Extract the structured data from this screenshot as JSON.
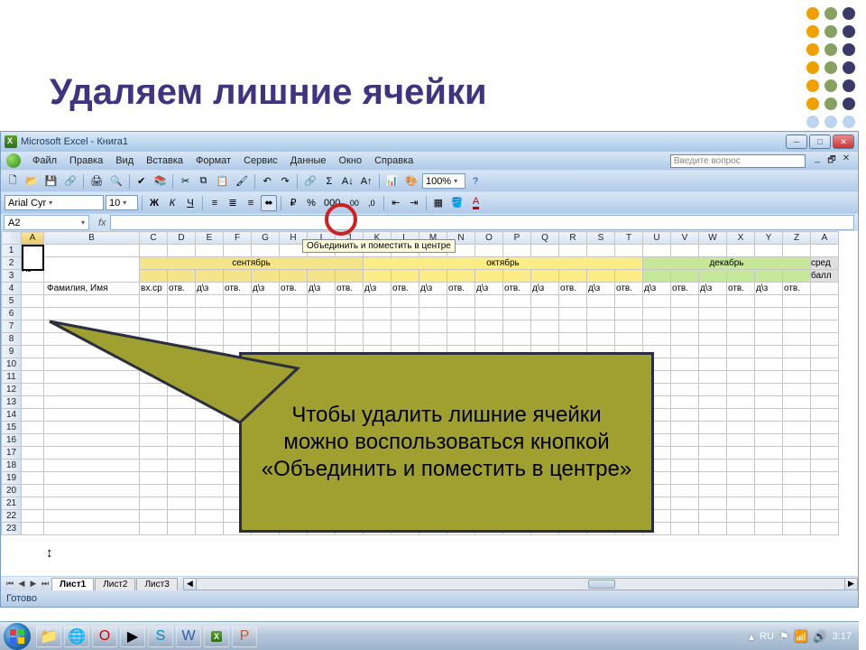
{
  "slide": {
    "title": "Удаляем лишние ячейки"
  },
  "window": {
    "title": "Microsoft Excel - Книга1"
  },
  "menus": [
    "Файл",
    "Правка",
    "Вид",
    "Вставка",
    "Формат",
    "Сервис",
    "Данные",
    "Окно",
    "Справка"
  ],
  "ask_placeholder": "Введите вопрос",
  "zoom": "100%",
  "font": "Arial Cyr",
  "font_size": "10",
  "namebox": "A2",
  "tooltip": "Объединить и поместить в центре",
  "columns": [
    "A",
    "B",
    "C",
    "D",
    "E",
    "F",
    "G",
    "H",
    "I",
    "J",
    "K",
    "L",
    "M",
    "N",
    "O",
    "P",
    "Q",
    "R",
    "S",
    "T",
    "U",
    "V",
    "W",
    "X",
    "Y",
    "Z",
    "A"
  ],
  "rows": [
    "1",
    "2",
    "3",
    "4",
    "5",
    "6",
    "7",
    "8",
    "9",
    "10",
    "11",
    "12",
    "13",
    "14",
    "15",
    "16",
    "17",
    "18",
    "19",
    "20",
    "21",
    "22",
    "23"
  ],
  "row2": {
    "no": "№",
    "sept": "сентябрь",
    "oct": "октябрь",
    "dec": "декабрь",
    "sred1": "сред",
    "sred2": "балл"
  },
  "row4": {
    "fam": "Фамилия, Имя",
    "vhsr": "вх.ср",
    "otv": "отв.",
    "dz": "д\\з"
  },
  "callout": "Чтобы удалить лишние ячейки можно воспользоваться кнопкой «Объединить и поместить в центре»",
  "tabs": [
    "Лист1",
    "Лист2",
    "Лист3"
  ],
  "status": "Готово",
  "tray": {
    "lang": "RU",
    "time": "3:17"
  }
}
